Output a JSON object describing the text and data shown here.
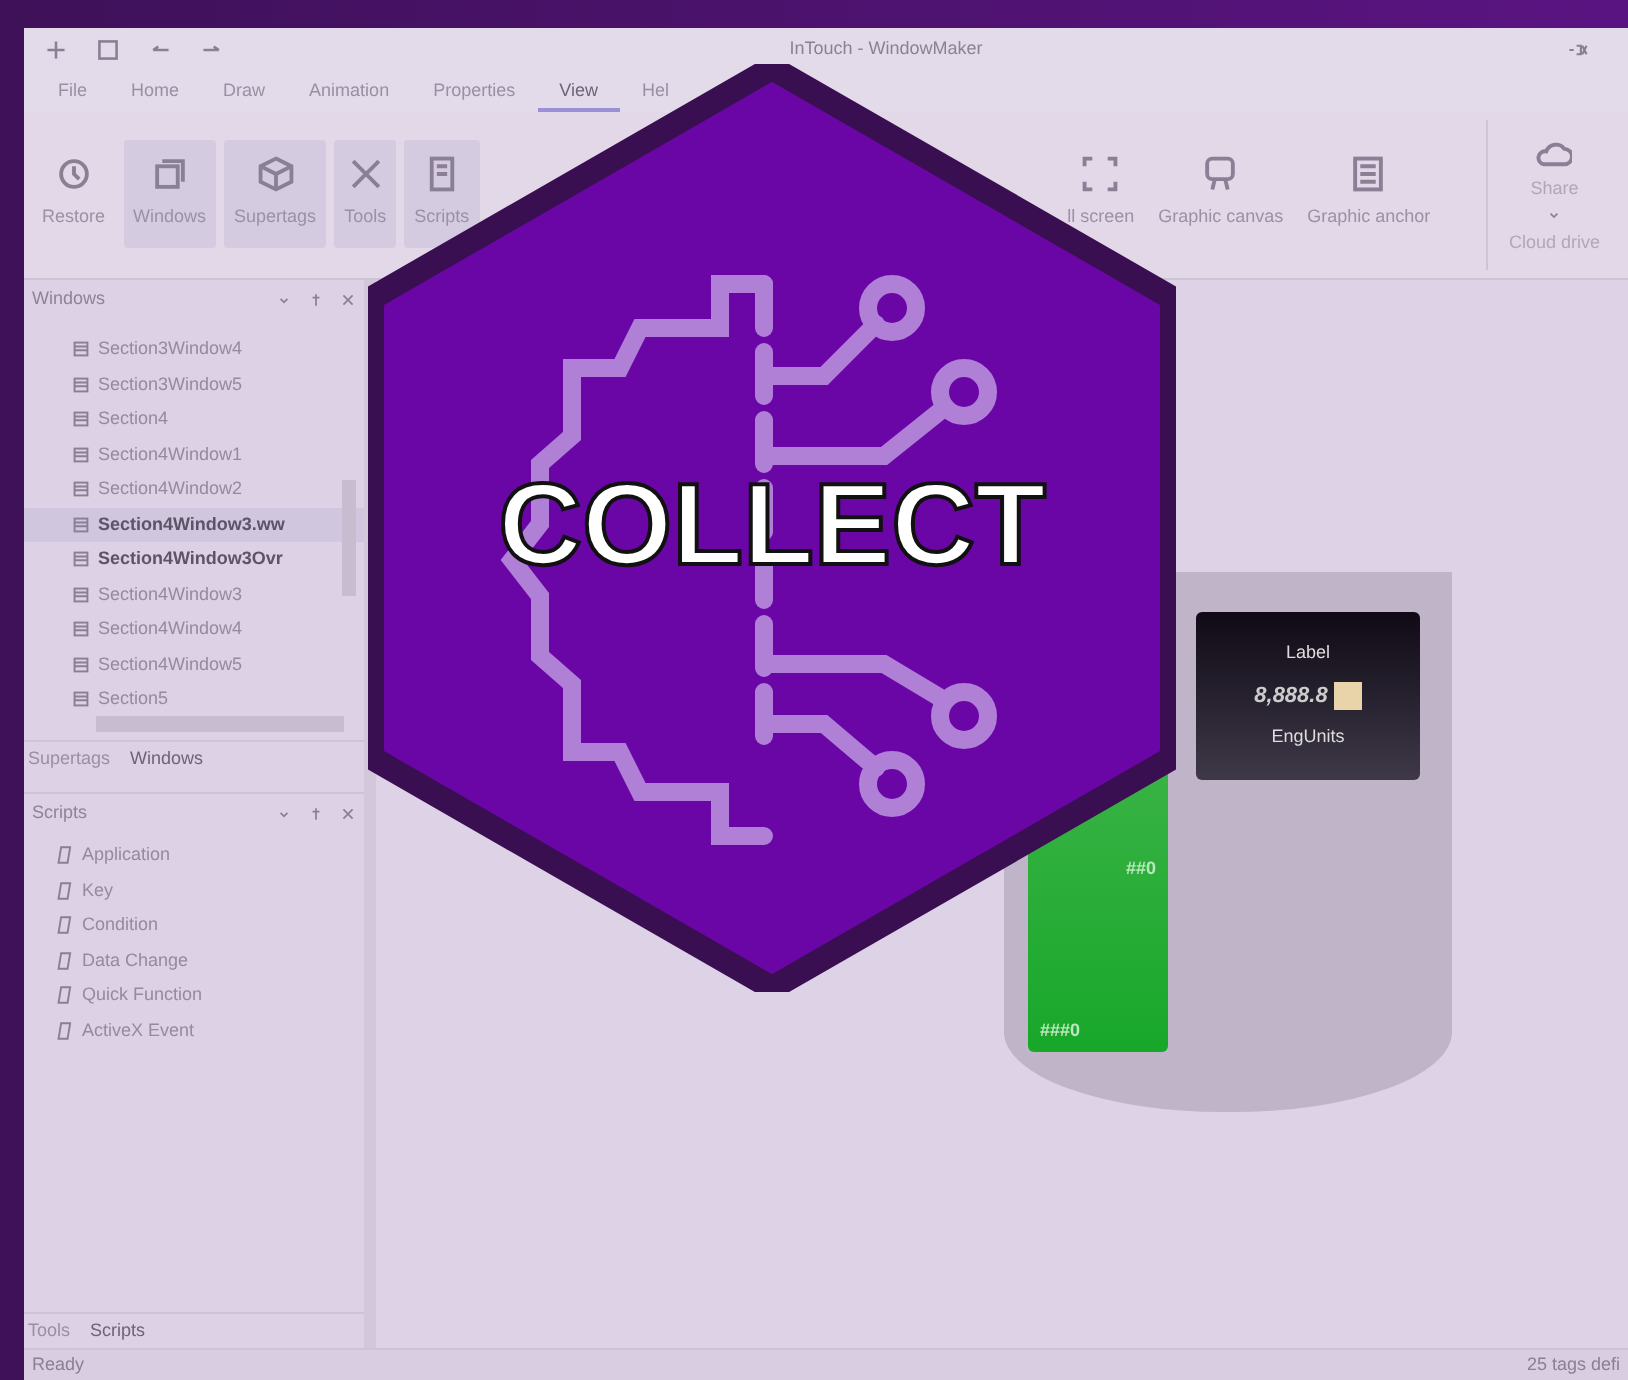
{
  "window": {
    "title": "InTouch - WindowMaker"
  },
  "menu_tabs": [
    {
      "label": "File",
      "selected": false
    },
    {
      "label": "Home",
      "selected": false
    },
    {
      "label": "Draw",
      "selected": false
    },
    {
      "label": "Animation",
      "selected": false
    },
    {
      "label": "Properties",
      "selected": false
    },
    {
      "label": "View",
      "selected": true
    },
    {
      "label": "Hel",
      "selected": false
    }
  ],
  "ribbon": {
    "buttons": [
      {
        "label": "Restore",
        "selected": false
      },
      {
        "label": "Windows",
        "selected": true
      },
      {
        "label": "Supertags",
        "selected": true
      },
      {
        "label": "Tools",
        "selected": true
      },
      {
        "label": "Scripts",
        "selected": true
      }
    ],
    "right_buttons": [
      {
        "label": "ll screen",
        "selected": false
      },
      {
        "label": "Graphic canvas",
        "selected": false
      },
      {
        "label": "Graphic anchor",
        "selected": false
      }
    ],
    "cloud": {
      "button": "Share",
      "caption": "Cloud drive"
    }
  },
  "windows_panel": {
    "title": "Windows",
    "items": [
      {
        "label": "Section3Window4",
        "bold": false,
        "selected": false
      },
      {
        "label": "Section3Window5",
        "bold": false,
        "selected": false
      },
      {
        "label": "Section4",
        "bold": false,
        "selected": false
      },
      {
        "label": "Section4Window1",
        "bold": false,
        "selected": false
      },
      {
        "label": "Section4Window2",
        "bold": false,
        "selected": false
      },
      {
        "label": "Section4Window3.ww",
        "bold": true,
        "selected": true
      },
      {
        "label": "Section4Window3Ovr",
        "bold": true,
        "selected": false
      },
      {
        "label": "Section4Window3",
        "bold": false,
        "selected": false
      },
      {
        "label": "Section4Window4",
        "bold": false,
        "selected": false
      },
      {
        "label": "Section4Window5",
        "bold": false,
        "selected": false
      },
      {
        "label": "Section5",
        "bold": false,
        "selected": false
      }
    ],
    "tabs": [
      {
        "label": "Supertags",
        "selected": false
      },
      {
        "label": "Windows",
        "selected": true
      }
    ]
  },
  "scripts_panel": {
    "title": "Scripts",
    "items": [
      "Application",
      "Key",
      "Condition",
      "Data Change",
      "Quick Function",
      "ActiveX Event"
    ],
    "tabs": [
      {
        "label": "Tools",
        "selected": false
      },
      {
        "label": "Scripts",
        "selected": true
      }
    ]
  },
  "canvas": {
    "gauge": {
      "label": "Label",
      "value": "8,888.8",
      "units": "EngUnits",
      "scale_top": "##0",
      "scale_bottom": "###0"
    }
  },
  "overlay": {
    "title": "COLLECT"
  },
  "status_bar": {
    "left": "Ready",
    "right": "25 tags defi"
  }
}
